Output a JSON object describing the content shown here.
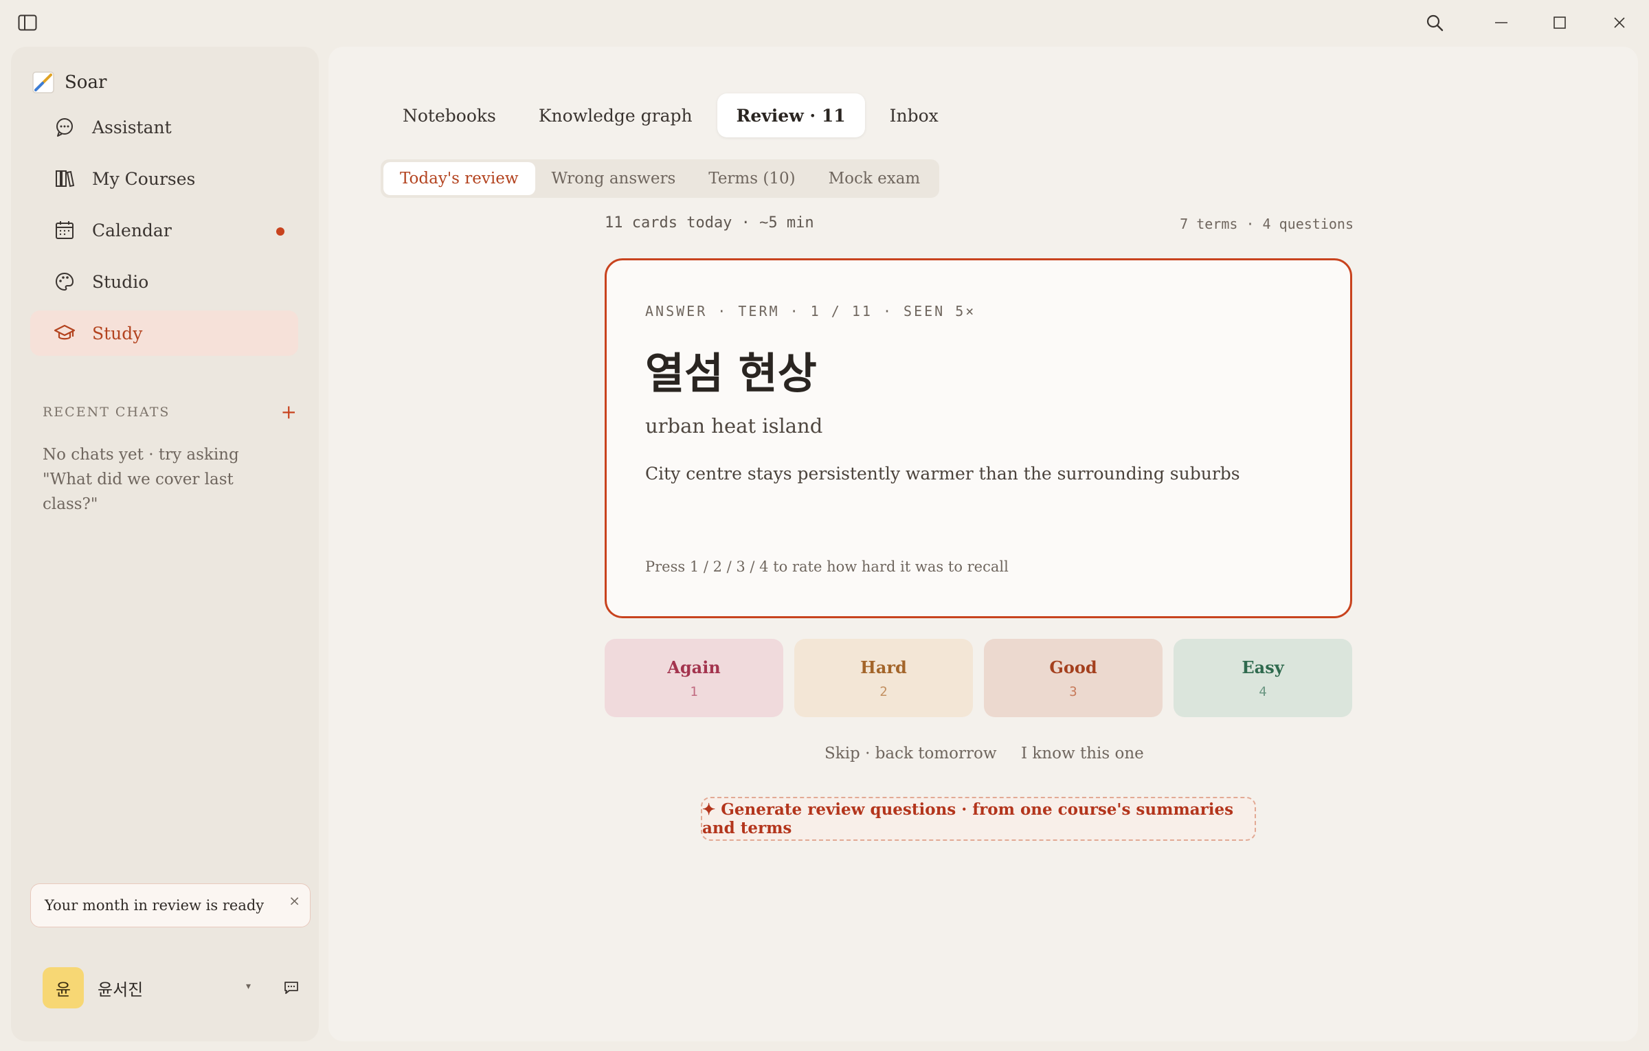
{
  "app": {
    "name": "Soar"
  },
  "sidebar": {
    "items": [
      {
        "label": "Assistant",
        "icon": "chat-bubble-icon"
      },
      {
        "label": "My Courses",
        "icon": "books-icon"
      },
      {
        "label": "Calendar",
        "icon": "calendar-icon",
        "has_notification": true
      },
      {
        "label": "Studio",
        "icon": "palette-icon"
      },
      {
        "label": "Study",
        "icon": "graduation-cap-icon",
        "active": true
      }
    ],
    "recent_chats": {
      "title": "RECENT CHATS",
      "add_label": "+",
      "empty_text": "No chats yet · try asking \"What did we cover last class?\""
    },
    "toast": {
      "text": "Your month in review is ready",
      "close_label": "×"
    },
    "user": {
      "avatar_initial": "윤",
      "name": "윤서진",
      "caret": "▾"
    }
  },
  "tabs": [
    {
      "label": "Notebooks"
    },
    {
      "label": "Knowledge graph"
    },
    {
      "label": "Review · 11",
      "active": true
    },
    {
      "label": "Inbox"
    }
  ],
  "subtabs": [
    {
      "label": "Today's review",
      "active": true
    },
    {
      "label": "Wrong answers"
    },
    {
      "label": "Terms (10)"
    },
    {
      "label": "Mock exam"
    }
  ],
  "review": {
    "summary_left": "11 cards today · ~5 min",
    "summary_right": "7 terms · 4 questions",
    "card": {
      "meta": "ANSWER · TERM · 1 / 11 · SEEN 5×",
      "term": "열섬 현상",
      "translation": "urban heat island",
      "definition": "City centre stays persistently warmer than the surrounding suburbs",
      "hint": "Press 1 / 2 / 3 / 4 to rate how hard it was to recall"
    },
    "ratings": [
      {
        "label": "Again",
        "key": "1"
      },
      {
        "label": "Hard",
        "key": "2"
      },
      {
        "label": "Good",
        "key": "3"
      },
      {
        "label": "Easy",
        "key": "4"
      }
    ],
    "skip_label": "Skip · back tomorrow",
    "know_label": "I know this one",
    "generate_label": "✦ Generate review questions · from one course's summaries and terms"
  },
  "colors": {
    "accent": "#c8431e",
    "background": "#f1ede6",
    "active_nav_bg": "#f6e1d9"
  }
}
